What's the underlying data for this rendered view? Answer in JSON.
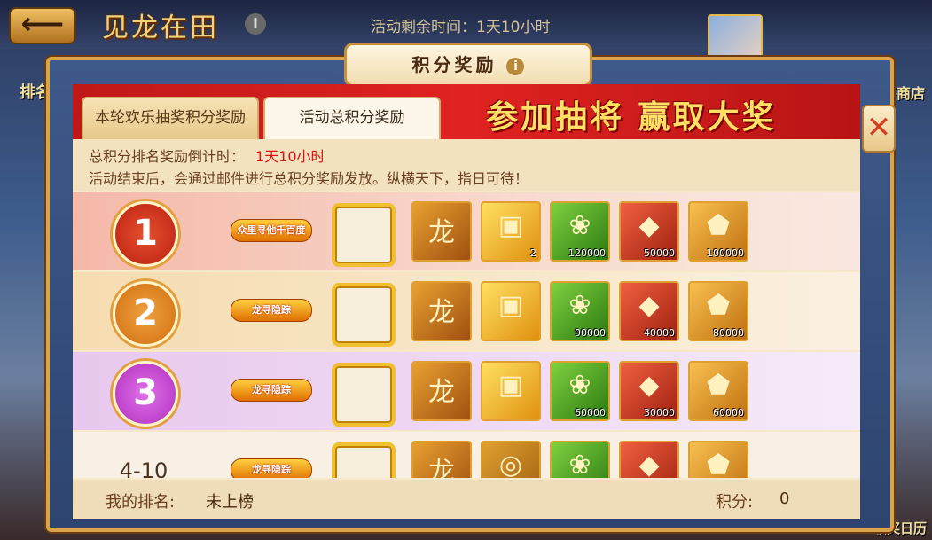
{
  "game_header": {
    "title": "见龙在田",
    "info_icon": "i",
    "time_left": "活动剩余时间：1天10小时",
    "left_side": "排名",
    "right_side": "将商店",
    "right_bottom": "领奖日历"
  },
  "dialog": {
    "title": "积分奖励",
    "title_info": "i",
    "close": "✕"
  },
  "tabs": [
    {
      "label": "本轮欢乐抽奖积分奖励",
      "active": false
    },
    {
      "label": "活动总积分奖励",
      "active": true
    }
  ],
  "banner": "参加抽将  赢取大奖",
  "info": {
    "countdown_label": "总积分排名奖励倒计时：",
    "countdown_value": "1天10小时",
    "description": "活动结束后，会通过邮件进行总积分奖励发放。纵横天下，指日可待！"
  },
  "ranks": [
    {
      "rank": "1",
      "title_badge": "众里寻他千百度",
      "items": [
        {
          "icon": "red-card-icon",
          "count": ""
        },
        {
          "icon": "gold-chest-icon",
          "count": "2"
        },
        {
          "icon": "green-jade-icon",
          "count": "120000"
        },
        {
          "icon": "red-gem-icon",
          "count": "50000"
        },
        {
          "icon": "gold-token-icon",
          "count": "100000"
        }
      ]
    },
    {
      "rank": "2",
      "title_badge": "龙寻隐踪",
      "items": [
        {
          "icon": "red-card-icon",
          "count": ""
        },
        {
          "icon": "gold-chest-icon",
          "count": ""
        },
        {
          "icon": "green-jade-icon",
          "count": "90000"
        },
        {
          "icon": "red-gem-icon",
          "count": "40000"
        },
        {
          "icon": "gold-token-icon",
          "count": "80000"
        }
      ]
    },
    {
      "rank": "3",
      "title_badge": "龙寻隐踪",
      "items": [
        {
          "icon": "red-card-icon",
          "count": ""
        },
        {
          "icon": "gold-chest-icon",
          "count": ""
        },
        {
          "icon": "green-jade-icon",
          "count": "60000"
        },
        {
          "icon": "red-gem-icon",
          "count": "30000"
        },
        {
          "icon": "gold-token-icon",
          "count": "60000"
        }
      ]
    },
    {
      "rank": "4-10",
      "title_badge": "龙寻隐踪",
      "items": [
        {
          "icon": "red-card-icon",
          "count": ""
        },
        {
          "icon": "gold-drum-icon",
          "count": ""
        },
        {
          "icon": "green-jade-icon",
          "count": ""
        },
        {
          "icon": "red-gem-icon",
          "count": ""
        },
        {
          "icon": "gold-token-icon",
          "count": ""
        }
      ]
    }
  ],
  "footer": {
    "my_rank_label": "我的排名:",
    "my_rank_value": "未上榜",
    "score_label": "积分:",
    "score_value": "0"
  }
}
